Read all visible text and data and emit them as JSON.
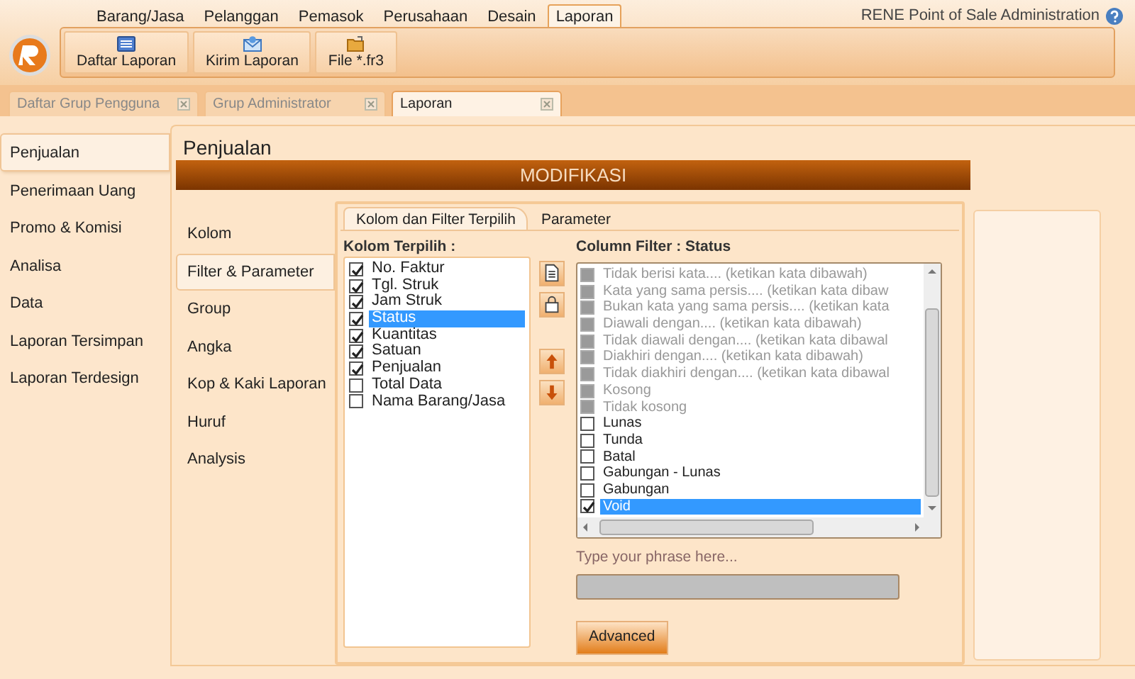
{
  "menu_tabs": [
    {
      "label": "Barang/Jasa",
      "selected": false
    },
    {
      "label": "Pelanggan",
      "selected": false
    },
    {
      "label": "Pemasok",
      "selected": false
    },
    {
      "label": "Perusahaan",
      "selected": false
    },
    {
      "label": "Desain",
      "selected": false
    },
    {
      "label": "Laporan",
      "selected": true
    }
  ],
  "app_title": "RENE Point of Sale Administration",
  "ribbon_buttons": [
    {
      "label": "Daftar Laporan"
    },
    {
      "label": "Kirim Laporan"
    },
    {
      "label": "File *.fr3"
    }
  ],
  "document_tabs": [
    {
      "label": "Daftar Grup Pengguna",
      "selected": false
    },
    {
      "label": "Grup Administrator",
      "selected": false
    },
    {
      "label": "Laporan",
      "selected": true
    }
  ],
  "sidebar": {
    "items": [
      {
        "label": "Penjualan",
        "selected": true
      },
      {
        "label": "Penerimaan Uang",
        "selected": false
      },
      {
        "label": "Promo & Komisi",
        "selected": false
      },
      {
        "label": "Analisa",
        "selected": false
      },
      {
        "label": "Data",
        "selected": false
      },
      {
        "label": "Laporan Tersimpan",
        "selected": false
      },
      {
        "label": "Laporan Terdesign",
        "selected": false
      }
    ]
  },
  "page_title": "Penjualan",
  "header": "MODIFIKASI",
  "sections": [
    {
      "label": "Kolom",
      "selected": false
    },
    {
      "label": "Filter & Parameter",
      "selected": true
    },
    {
      "label": "Group",
      "selected": false
    },
    {
      "label": "Angka",
      "selected": false
    },
    {
      "label": "Kop &  Kaki Laporan",
      "selected": false
    },
    {
      "label": "Huruf",
      "selected": false
    },
    {
      "label": "Analysis",
      "selected": false
    }
  ],
  "tabs": [
    {
      "label": "Kolom dan Filter Terpilih",
      "selected": true
    },
    {
      "label": "Parameter",
      "selected": false
    }
  ],
  "columns": {
    "title": "Kolom Terpilih :",
    "items": [
      {
        "label": "No. Faktur",
        "checked": true,
        "selected": false
      },
      {
        "label": "Tgl. Struk",
        "checked": true,
        "selected": false
      },
      {
        "label": "Jam Struk",
        "checked": true,
        "selected": false
      },
      {
        "label": "Status",
        "checked": true,
        "selected": true
      },
      {
        "label": "Kuantitas",
        "checked": true,
        "selected": false
      },
      {
        "label": "Satuan",
        "checked": true,
        "selected": false
      },
      {
        "label": "Penjualan",
        "checked": true,
        "selected": false
      },
      {
        "label": "Total Data",
        "checked": false,
        "selected": false
      },
      {
        "label": "Nama Barang/Jasa",
        "checked": false,
        "selected": false
      }
    ]
  },
  "column_filter": {
    "label": "Column Filter :",
    "column": "Status",
    "items": [
      {
        "label": "Tidak berisi kata.... (ketikan kata dibawah)",
        "checked": false,
        "selected": false,
        "disabled": true
      },
      {
        "label": "Kata yang sama persis.... (ketikan kata dibaw",
        "checked": false,
        "selected": false,
        "disabled": true
      },
      {
        "label": "Bukan kata yang sama persis.... (ketikan kata",
        "checked": false,
        "selected": false,
        "disabled": true
      },
      {
        "label": "Diawali dengan.... (ketikan kata dibawah)",
        "checked": false,
        "selected": false,
        "disabled": true
      },
      {
        "label": "Tidak diawali dengan.... (ketikan kata dibawal",
        "checked": false,
        "selected": false,
        "disabled": true
      },
      {
        "label": "Diakhiri dengan.... (ketikan kata dibawah)",
        "checked": false,
        "selected": false,
        "disabled": true
      },
      {
        "label": "Tidak diakhiri dengan.... (ketikan kata dibawal",
        "checked": false,
        "selected": false,
        "disabled": true
      },
      {
        "label": "Kosong",
        "checked": false,
        "selected": false,
        "disabled": true
      },
      {
        "label": "Tidak kosong",
        "checked": false,
        "selected": false,
        "disabled": true
      },
      {
        "label": "Lunas",
        "checked": false,
        "selected": false,
        "disabled": false
      },
      {
        "label": "Tunda",
        "checked": false,
        "selected": false,
        "disabled": false
      },
      {
        "label": "Batal",
        "checked": false,
        "selected": false,
        "disabled": false
      },
      {
        "label": "Gabungan - Lunas",
        "checked": false,
        "selected": false,
        "disabled": false
      },
      {
        "label": "Gabungan",
        "checked": false,
        "selected": false,
        "disabled": false
      },
      {
        "label": "Void",
        "checked": true,
        "selected": true,
        "disabled": false
      }
    ]
  },
  "phrase": {
    "label": "Type your phrase here...",
    "disabled": true
  },
  "advanced_button": "Advanced"
}
